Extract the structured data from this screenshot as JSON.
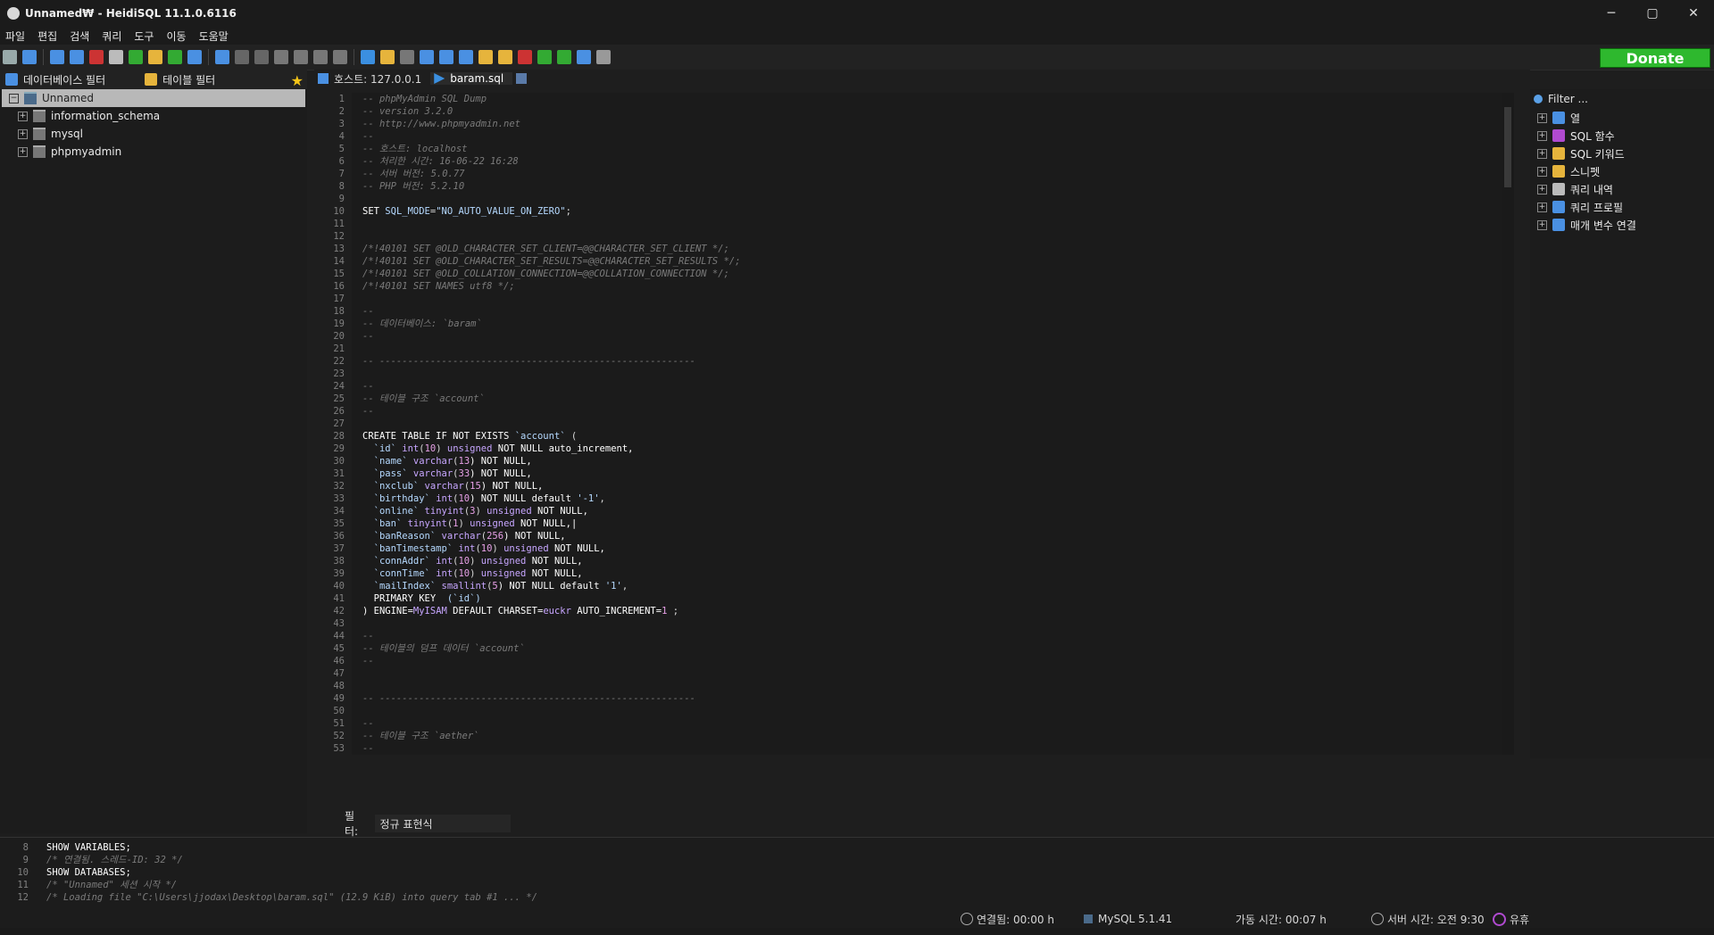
{
  "window": {
    "title": "Unnamed₩ - HeidiSQL 11.1.0.6116",
    "controls": {
      "minimize": "─",
      "maximize": "▢",
      "close": "✕"
    }
  },
  "menu": [
    "파일",
    "편집",
    "검색",
    "쿼리",
    "도구",
    "이동",
    "도움말"
  ],
  "toolbar": {
    "donate_label": "Donate",
    "icons": [
      "connect-icon",
      "new-window-icon",
      "copy-icon",
      "paste-icon",
      "undo-icon",
      "print-icon",
      "refresh-icon",
      "users-icon",
      "export-icon",
      "sync-icon",
      "help-icon",
      "first-icon",
      "last-icon",
      "add-icon",
      "remove-icon",
      "apply-icon",
      "cancel-icon",
      "run-icon",
      "folder-icon",
      "save-icon",
      "save-as-icon",
      "find-icon",
      "replace-icon",
      "clean-icon",
      "warning-icon",
      "disk-icon",
      "reformat-icon",
      "wrap-icon",
      "info-icon",
      "close-tab-icon"
    ]
  },
  "left": {
    "db_filter_label": "데이터베이스 필터",
    "table_filter_label": "테이블 필터",
    "tree": [
      {
        "label": "Unnamed",
        "selected": true,
        "expanded": true
      },
      {
        "label": "information_schema",
        "selected": false
      },
      {
        "label": "mysql",
        "selected": false
      },
      {
        "label": "phpmyadmin",
        "selected": false
      }
    ]
  },
  "tabs": {
    "host": "호스트: 127.0.0.1",
    "file": "baram.sql"
  },
  "editor_lines": [
    {
      "n": "1",
      "parts": [
        {
          "t": "-- phpMyAdmin SQL Dump",
          "c": "comment"
        }
      ]
    },
    {
      "n": "2",
      "parts": [
        {
          "t": "-- version 3.2.0",
          "c": "comment"
        }
      ]
    },
    {
      "n": "3",
      "parts": [
        {
          "t": "-- http://www.phpmyadmin.net",
          "c": "comment"
        }
      ]
    },
    {
      "n": "4",
      "parts": [
        {
          "t": "--",
          "c": "comment"
        }
      ]
    },
    {
      "n": "5",
      "parts": [
        {
          "t": "-- 호스트: localhost",
          "c": "comment"
        }
      ]
    },
    {
      "n": "6",
      "parts": [
        {
          "t": "-- 처리한 시간: 16-06-22 16:28",
          "c": "comment"
        }
      ]
    },
    {
      "n": "7",
      "parts": [
        {
          "t": "-- 서버 버전: 5.0.77",
          "c": "comment"
        }
      ]
    },
    {
      "n": "8",
      "parts": [
        {
          "t": "-- PHP 버전: 5.2.10",
          "c": "comment"
        }
      ]
    },
    {
      "n": "9",
      "parts": []
    },
    {
      "n": "10",
      "parts": [
        {
          "t": "SET ",
          "c": "kw"
        },
        {
          "t": "SQL_MODE",
          "c": "str"
        },
        {
          "t": "=",
          "c": "ident"
        },
        {
          "t": "\"NO_AUTO_VALUE_ON_ZERO\"",
          "c": "str"
        },
        {
          "t": ";",
          "c": "ident"
        }
      ]
    },
    {
      "n": "11",
      "parts": []
    },
    {
      "n": "12",
      "parts": []
    },
    {
      "n": "13",
      "parts": [
        {
          "t": "/*!40101 SET @OLD_CHARACTER_SET_CLIENT=@@CHARACTER_SET_CLIENT */;",
          "c": "comment"
        }
      ]
    },
    {
      "n": "14",
      "parts": [
        {
          "t": "/*!40101 SET @OLD_CHARACTER_SET_RESULTS=@@CHARACTER_SET_RESULTS */;",
          "c": "comment"
        }
      ]
    },
    {
      "n": "15",
      "parts": [
        {
          "t": "/*!40101 SET @OLD_COLLATION_CONNECTION=@@COLLATION_CONNECTION */;",
          "c": "comment"
        }
      ]
    },
    {
      "n": "16",
      "parts": [
        {
          "t": "/*!40101 SET NAMES utf8 */;",
          "c": "comment"
        }
      ]
    },
    {
      "n": "17",
      "parts": []
    },
    {
      "n": "18",
      "parts": [
        {
          "t": "--",
          "c": "comment"
        }
      ]
    },
    {
      "n": "19",
      "parts": [
        {
          "t": "-- 데이터베이스: `baram`",
          "c": "comment"
        }
      ]
    },
    {
      "n": "20",
      "parts": [
        {
          "t": "--",
          "c": "comment"
        }
      ]
    },
    {
      "n": "21",
      "parts": []
    },
    {
      "n": "22",
      "parts": [
        {
          "t": "-- --------------------------------------------------------",
          "c": "comment"
        }
      ]
    },
    {
      "n": "23",
      "parts": []
    },
    {
      "n": "24",
      "parts": [
        {
          "t": "--",
          "c": "comment"
        }
      ]
    },
    {
      "n": "25",
      "parts": [
        {
          "t": "-- 테이블 구조 `account`",
          "c": "comment"
        }
      ]
    },
    {
      "n": "26",
      "parts": [
        {
          "t": "--",
          "c": "comment"
        }
      ]
    },
    {
      "n": "27",
      "parts": []
    },
    {
      "n": "28",
      "parts": [
        {
          "t": "CREATE TABLE IF NOT EXISTS ",
          "c": "kw"
        },
        {
          "t": "`account`",
          "c": "str"
        },
        {
          "t": " (",
          "c": "ident"
        }
      ]
    },
    {
      "n": "29",
      "parts": [
        {
          "t": "  `id` ",
          "c": "str"
        },
        {
          "t": "int",
          "c": "type"
        },
        {
          "t": "(",
          "c": "ident"
        },
        {
          "t": "10",
          "c": "num"
        },
        {
          "t": ") ",
          "c": "ident"
        },
        {
          "t": "unsigned",
          "c": "type"
        },
        {
          "t": " NOT NULL auto_increment,",
          "c": "kw"
        }
      ]
    },
    {
      "n": "30",
      "parts": [
        {
          "t": "  `name` ",
          "c": "str"
        },
        {
          "t": "varchar",
          "c": "type"
        },
        {
          "t": "(",
          "c": "ident"
        },
        {
          "t": "13",
          "c": "num"
        },
        {
          "t": ") NOT NULL,",
          "c": "kw"
        }
      ]
    },
    {
      "n": "31",
      "parts": [
        {
          "t": "  `pass` ",
          "c": "str"
        },
        {
          "t": "varchar",
          "c": "type"
        },
        {
          "t": "(",
          "c": "ident"
        },
        {
          "t": "33",
          "c": "num"
        },
        {
          "t": ") NOT NULL,",
          "c": "kw"
        }
      ]
    },
    {
      "n": "32",
      "parts": [
        {
          "t": "  `nxclub` ",
          "c": "str"
        },
        {
          "t": "varchar",
          "c": "type"
        },
        {
          "t": "(",
          "c": "ident"
        },
        {
          "t": "15",
          "c": "num"
        },
        {
          "t": ") NOT NULL,",
          "c": "kw"
        }
      ]
    },
    {
      "n": "33",
      "parts": [
        {
          "t": "  `birthday` ",
          "c": "str"
        },
        {
          "t": "int",
          "c": "type"
        },
        {
          "t": "(",
          "c": "ident"
        },
        {
          "t": "10",
          "c": "num"
        },
        {
          "t": ") NOT NULL default ",
          "c": "kw"
        },
        {
          "t": "'-1'",
          "c": "str"
        },
        {
          "t": ",",
          "c": "ident"
        }
      ]
    },
    {
      "n": "34",
      "parts": [
        {
          "t": "  `online` ",
          "c": "str"
        },
        {
          "t": "tinyint",
          "c": "type"
        },
        {
          "t": "(",
          "c": "ident"
        },
        {
          "t": "3",
          "c": "num"
        },
        {
          "t": ") ",
          "c": "ident"
        },
        {
          "t": "unsigned",
          "c": "type"
        },
        {
          "t": " NOT NULL,",
          "c": "kw"
        }
      ]
    },
    {
      "n": "35",
      "parts": [
        {
          "t": "  `ban` ",
          "c": "str"
        },
        {
          "t": "tinyint",
          "c": "type"
        },
        {
          "t": "(",
          "c": "ident"
        },
        {
          "t": "1",
          "c": "num"
        },
        {
          "t": ") ",
          "c": "ident"
        },
        {
          "t": "unsigned",
          "c": "type"
        },
        {
          "t": " NOT NULL,|",
          "c": "kw"
        }
      ]
    },
    {
      "n": "36",
      "parts": [
        {
          "t": "  `banReason` ",
          "c": "str"
        },
        {
          "t": "varchar",
          "c": "type"
        },
        {
          "t": "(",
          "c": "ident"
        },
        {
          "t": "256",
          "c": "num"
        },
        {
          "t": ") NOT NULL,",
          "c": "kw"
        }
      ]
    },
    {
      "n": "37",
      "parts": [
        {
          "t": "  `banTimestamp` ",
          "c": "str"
        },
        {
          "t": "int",
          "c": "type"
        },
        {
          "t": "(",
          "c": "ident"
        },
        {
          "t": "10",
          "c": "num"
        },
        {
          "t": ") ",
          "c": "ident"
        },
        {
          "t": "unsigned",
          "c": "type"
        },
        {
          "t": " NOT NULL,",
          "c": "kw"
        }
      ]
    },
    {
      "n": "38",
      "parts": [
        {
          "t": "  `connAddr` ",
          "c": "str"
        },
        {
          "t": "int",
          "c": "type"
        },
        {
          "t": "(",
          "c": "ident"
        },
        {
          "t": "10",
          "c": "num"
        },
        {
          "t": ") ",
          "c": "ident"
        },
        {
          "t": "unsigned",
          "c": "type"
        },
        {
          "t": " NOT NULL,",
          "c": "kw"
        }
      ]
    },
    {
      "n": "39",
      "parts": [
        {
          "t": "  `connTime` ",
          "c": "str"
        },
        {
          "t": "int",
          "c": "type"
        },
        {
          "t": "(",
          "c": "ident"
        },
        {
          "t": "10",
          "c": "num"
        },
        {
          "t": ") ",
          "c": "ident"
        },
        {
          "t": "unsigned",
          "c": "type"
        },
        {
          "t": " NOT NULL,",
          "c": "kw"
        }
      ]
    },
    {
      "n": "40",
      "parts": [
        {
          "t": "  `mailIndex` ",
          "c": "str"
        },
        {
          "t": "smallint",
          "c": "type"
        },
        {
          "t": "(",
          "c": "ident"
        },
        {
          "t": "5",
          "c": "num"
        },
        {
          "t": ") NOT NULL default ",
          "c": "kw"
        },
        {
          "t": "'1'",
          "c": "str"
        },
        {
          "t": ",",
          "c": "ident"
        }
      ]
    },
    {
      "n": "41",
      "parts": [
        {
          "t": "  PRIMARY KEY  ",
          "c": "kw"
        },
        {
          "t": "(`id`)",
          "c": "str"
        }
      ]
    },
    {
      "n": "42",
      "parts": [
        {
          "t": ") ENGINE=",
          "c": "kw"
        },
        {
          "t": "MyISAM",
          "c": "type"
        },
        {
          "t": " DEFAULT CHARSET=",
          "c": "kw"
        },
        {
          "t": "euckr",
          "c": "type"
        },
        {
          "t": " AUTO_INCREMENT=",
          "c": "kw"
        },
        {
          "t": "1",
          "c": "num"
        },
        {
          "t": " ;",
          "c": "ident"
        }
      ]
    },
    {
      "n": "43",
      "parts": []
    },
    {
      "n": "44",
      "parts": [
        {
          "t": "--",
          "c": "comment"
        }
      ]
    },
    {
      "n": "45",
      "parts": [
        {
          "t": "-- 테이블의 덤프 데이터 `account`",
          "c": "comment"
        }
      ]
    },
    {
      "n": "46",
      "parts": [
        {
          "t": "--",
          "c": "comment"
        }
      ]
    },
    {
      "n": "47",
      "parts": []
    },
    {
      "n": "48",
      "parts": []
    },
    {
      "n": "49",
      "parts": [
        {
          "t": "-- --------------------------------------------------------",
          "c": "comment"
        }
      ]
    },
    {
      "n": "50",
      "parts": []
    },
    {
      "n": "51",
      "parts": [
        {
          "t": "--",
          "c": "comment"
        }
      ]
    },
    {
      "n": "52",
      "parts": [
        {
          "t": "-- 테이블 구조 `aether`",
          "c": "comment"
        }
      ]
    },
    {
      "n": "53",
      "parts": [
        {
          "t": "--",
          "c": "comment"
        }
      ]
    }
  ],
  "filter": {
    "label": "필터:",
    "placeholder": "정규 표현식"
  },
  "helpers": {
    "filter_placeholder": "Filter ...",
    "items": [
      "열",
      "SQL 함수",
      "SQL 키워드",
      "스니펫",
      "쿼리 내역",
      "쿼리 프로필",
      "매개 변수 연결"
    ]
  },
  "log_lines": [
    {
      "n": "8",
      "t": "SHOW VARIABLES;",
      "c": "kw"
    },
    {
      "n": "9",
      "t": "/* 연결됨. 스레드-ID: 32 */",
      "c": "comment"
    },
    {
      "n": "10",
      "t": "SHOW DATABASES;",
      "c": "kw"
    },
    {
      "n": "11",
      "t": "/* \"Unnamed\" 세션 시작 */",
      "c": "comment"
    },
    {
      "n": "12",
      "t": "/* Loading file \"C:\\Users\\jjodax\\Desktop\\baram.sql\" (12.9 KiB) into query tab #1 ... */",
      "c": "comment"
    }
  ],
  "status": {
    "connected": "연결됨: 00:00 h",
    "server": "MySQL 5.1.41",
    "uptime": "가동 시간: 00:07 h",
    "server_time": "서버 시간: 오전 9:30",
    "idle": "유휴"
  },
  "colors": {
    "donate_bg": "#2eb82e",
    "accent_blue": "#4a90e2"
  }
}
